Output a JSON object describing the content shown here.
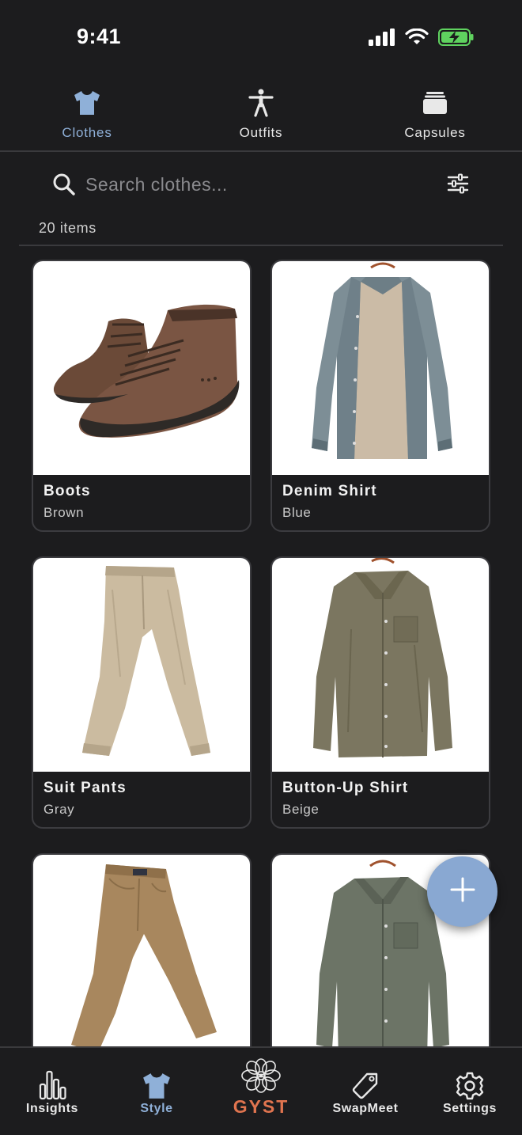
{
  "status_bar": {
    "time": "9:41"
  },
  "top_tabs": [
    {
      "label": "Clothes",
      "icon": "tshirt-icon",
      "active": true
    },
    {
      "label": "Outfits",
      "icon": "person-icon",
      "active": false
    },
    {
      "label": "Capsules",
      "icon": "capsule-stack-icon",
      "active": false
    }
  ],
  "search": {
    "placeholder": "Search clothes...",
    "value": ""
  },
  "items_count": "20 items",
  "items": [
    {
      "name": "Boots",
      "color": "Brown"
    },
    {
      "name": "Denim Shirt",
      "color": "Blue"
    },
    {
      "name": "Suit Pants",
      "color": "Gray"
    },
    {
      "name": "Button-Up Shirt",
      "color": "Beige"
    },
    {
      "name": "",
      "color": ""
    },
    {
      "name": "",
      "color": ""
    }
  ],
  "bottom_nav": {
    "insights": "Insights",
    "style": "Style",
    "logo": "GYST",
    "swapmeet": "SwapMeet",
    "settings": "Settings"
  },
  "colors": {
    "background": "#1c1c1e",
    "accent": "#8fb0d8",
    "fab": "#89a8d2",
    "logo_text": "#e0744f"
  }
}
